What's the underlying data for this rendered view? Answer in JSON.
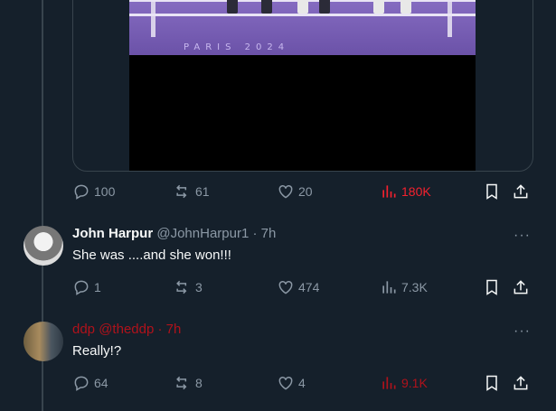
{
  "main_post": {
    "media": {
      "mat_text": "PARIS 2024"
    },
    "actions": {
      "replies": "100",
      "reposts": "61",
      "likes": "20",
      "views": "180K"
    }
  },
  "replies": [
    {
      "name": "John Harpur",
      "handle": "@JohnHarpur1",
      "separator": "·",
      "time": "7h",
      "text": "She was ....and she won!!!",
      "actions": {
        "replies": "1",
        "reposts": "3",
        "likes": "474",
        "views": "7.3K"
      }
    },
    {
      "name": "ddp",
      "handle": "@theddp",
      "separator": "·",
      "time": "7h",
      "text": "Really!?",
      "actions": {
        "replies": "64",
        "reposts": "8",
        "likes": "4",
        "views": "9.1K"
      }
    }
  ],
  "more_label": "···",
  "colors": {
    "background": "#15202b",
    "muted": "#8b98a5",
    "views_red": "#f4212e",
    "name_red": "#b0121b"
  },
  "icons": [
    "reply-icon",
    "repost-icon",
    "like-icon",
    "views-icon",
    "bookmark-icon",
    "share-icon",
    "more-icon"
  ]
}
